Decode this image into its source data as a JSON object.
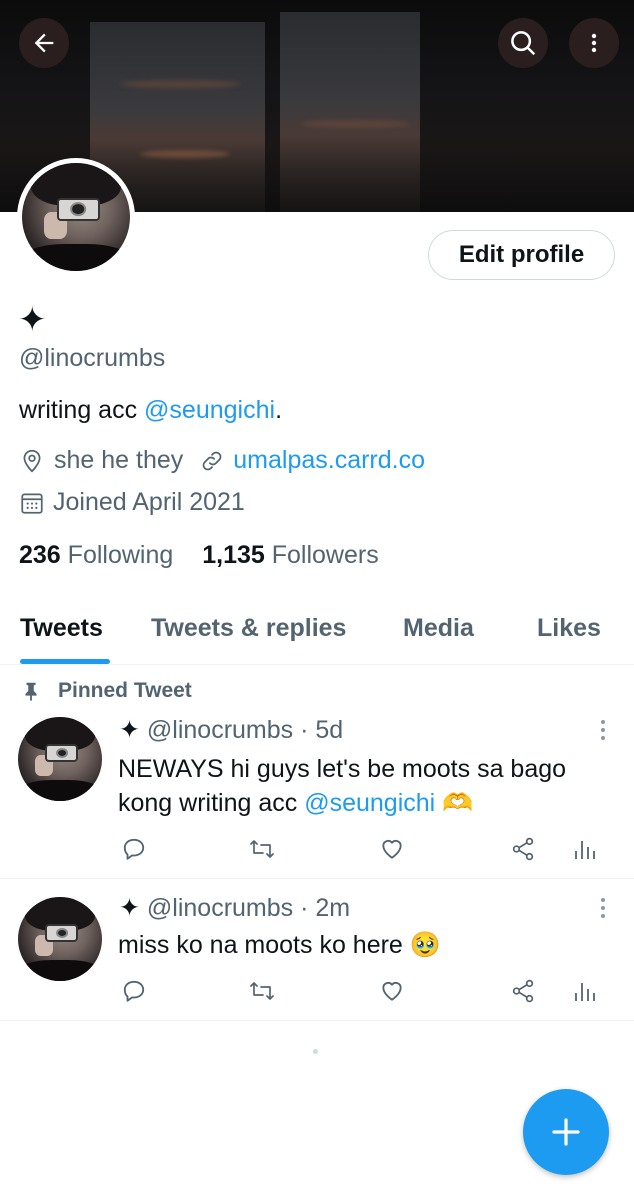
{
  "header": {
    "back_icon": "arrow-left-icon",
    "search_icon": "search-icon",
    "more_icon": "more-vertical-icon"
  },
  "profile": {
    "display_name": "✦",
    "handle": "@linocrumbs",
    "bio_text": "writing acc ",
    "bio_mention": "@seungichi",
    "bio_end": ".",
    "location": "she he they",
    "link": "umalpas.carrd.co",
    "joined": "Joined April 2021",
    "following_count": "236",
    "following_label": "Following",
    "followers_count": "1,135",
    "followers_label": "Followers",
    "edit_label": "Edit profile"
  },
  "tabs": [
    "Tweets",
    "Tweets & replies",
    "Media",
    "Likes"
  ],
  "pinned_label": "Pinned Tweet",
  "tweets": [
    {
      "name": "✦",
      "handle": "@linocrumbs",
      "time": "· 5d",
      "text_line1": "NEWAYS hi guys let's be moots sa bago",
      "text_line2_prefix": "kong writing acc ",
      "text_mention": "@seungichi",
      "emoji": "🫶"
    },
    {
      "name": "✦",
      "handle": "@linocrumbs",
      "time": "· 2m",
      "text": "miss ko na moots ko here",
      "emoji": "🥹"
    }
  ],
  "colors": {
    "accent": "#1d9bf0",
    "text_primary": "#0f1419",
    "text_secondary": "#536471",
    "border": "#eff3f4"
  }
}
